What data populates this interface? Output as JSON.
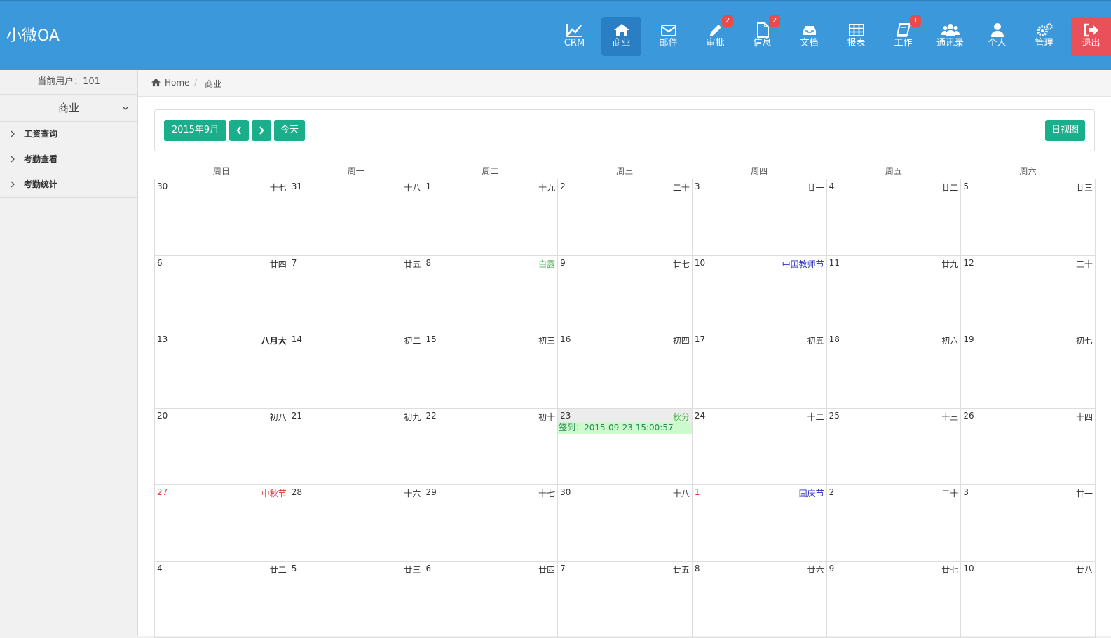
{
  "app": {
    "title": "小微OA"
  },
  "nav": [
    {
      "key": "crm",
      "label": "CRM",
      "icon": "line-chart-icon",
      "badge": null
    },
    {
      "key": "biz",
      "label": "商业",
      "icon": "home-icon",
      "badge": null,
      "active": true
    },
    {
      "key": "mail",
      "label": "邮件",
      "icon": "envelope-icon",
      "badge": null
    },
    {
      "key": "approve",
      "label": "审批",
      "icon": "pencil-icon",
      "badge": "2"
    },
    {
      "key": "info",
      "label": "信息",
      "icon": "file-icon",
      "badge": "2"
    },
    {
      "key": "doc",
      "label": "文档",
      "icon": "inbox-icon",
      "badge": null
    },
    {
      "key": "report",
      "label": "报表",
      "icon": "table-icon",
      "badge": null
    },
    {
      "key": "work",
      "label": "工作",
      "icon": "book-icon",
      "badge": "1"
    },
    {
      "key": "contacts",
      "label": "通讯录",
      "icon": "users-icon",
      "badge": null
    },
    {
      "key": "personal",
      "label": "个人",
      "icon": "user-icon",
      "badge": null
    },
    {
      "key": "admin",
      "label": "管理",
      "icon": "gears-icon",
      "badge": null
    },
    {
      "key": "logout",
      "label": "退出",
      "icon": "sign-out-icon",
      "badge": null
    }
  ],
  "sidebar": {
    "current_user": "当前用户：101",
    "group": "商业",
    "items": [
      "工资查询",
      "考勤查看",
      "考勤统计"
    ]
  },
  "breadcrumb": {
    "home": "Home",
    "sep": "/",
    "current": "商业"
  },
  "toolbar": {
    "month": "2015年9月",
    "today": "今天",
    "day_view": "日视图"
  },
  "calendar": {
    "weekdays": [
      "周日",
      "周一",
      "周二",
      "周三",
      "周四",
      "周五",
      "周六"
    ],
    "weeks": [
      [
        {
          "d": "30",
          "l": "十七"
        },
        {
          "d": "31",
          "l": "十八"
        },
        {
          "d": "1",
          "l": "十九"
        },
        {
          "d": "2",
          "l": "二十"
        },
        {
          "d": "3",
          "l": "廿一"
        },
        {
          "d": "4",
          "l": "廿二"
        },
        {
          "d": "5",
          "l": "廿三"
        }
      ],
      [
        {
          "d": "6",
          "l": "廿四"
        },
        {
          "d": "7",
          "l": "廿五"
        },
        {
          "d": "8",
          "l": "白露",
          "t": "term"
        },
        {
          "d": "9",
          "l": "廿七"
        },
        {
          "d": "10",
          "l": "中国教师节",
          "t": "fest"
        },
        {
          "d": "11",
          "l": "廿九"
        },
        {
          "d": "12",
          "l": "三十"
        }
      ],
      [
        {
          "d": "13",
          "l": "八月大",
          "t": "bold"
        },
        {
          "d": "14",
          "l": "初二"
        },
        {
          "d": "15",
          "l": "初三"
        },
        {
          "d": "16",
          "l": "初四"
        },
        {
          "d": "17",
          "l": "初五"
        },
        {
          "d": "18",
          "l": "初六"
        },
        {
          "d": "19",
          "l": "初七"
        }
      ],
      [
        {
          "d": "20",
          "l": "初八"
        },
        {
          "d": "21",
          "l": "初九"
        },
        {
          "d": "22",
          "l": "初十"
        },
        {
          "d": "23",
          "l": "秋分",
          "t": "term",
          "today": true,
          "event": "签到：2015-09-23 15:00:57"
        },
        {
          "d": "24",
          "l": "十二"
        },
        {
          "d": "25",
          "l": "十三"
        },
        {
          "d": "26",
          "l": "十四"
        }
      ],
      [
        {
          "d": "27",
          "l": "中秋节",
          "t": "red",
          "dred": true
        },
        {
          "d": "28",
          "l": "十六"
        },
        {
          "d": "29",
          "l": "十七"
        },
        {
          "d": "30",
          "l": "十八"
        },
        {
          "d": "1",
          "l": "国庆节",
          "t": "fest",
          "dred": true
        },
        {
          "d": "2",
          "l": "二十"
        },
        {
          "d": "3",
          "l": "廿一"
        }
      ],
      [
        {
          "d": "4",
          "l": "廿二"
        },
        {
          "d": "5",
          "l": "廿三"
        },
        {
          "d": "6",
          "l": "廿四"
        },
        {
          "d": "7",
          "l": "廿五"
        },
        {
          "d": "8",
          "l": "廿六"
        },
        {
          "d": "9",
          "l": "廿七"
        },
        {
          "d": "10",
          "l": "廿八"
        }
      ]
    ]
  },
  "colors": {
    "header": "#3b99db",
    "accent": "#1aae8a",
    "logout": "#e9505a",
    "badge": "#e94b4b"
  }
}
